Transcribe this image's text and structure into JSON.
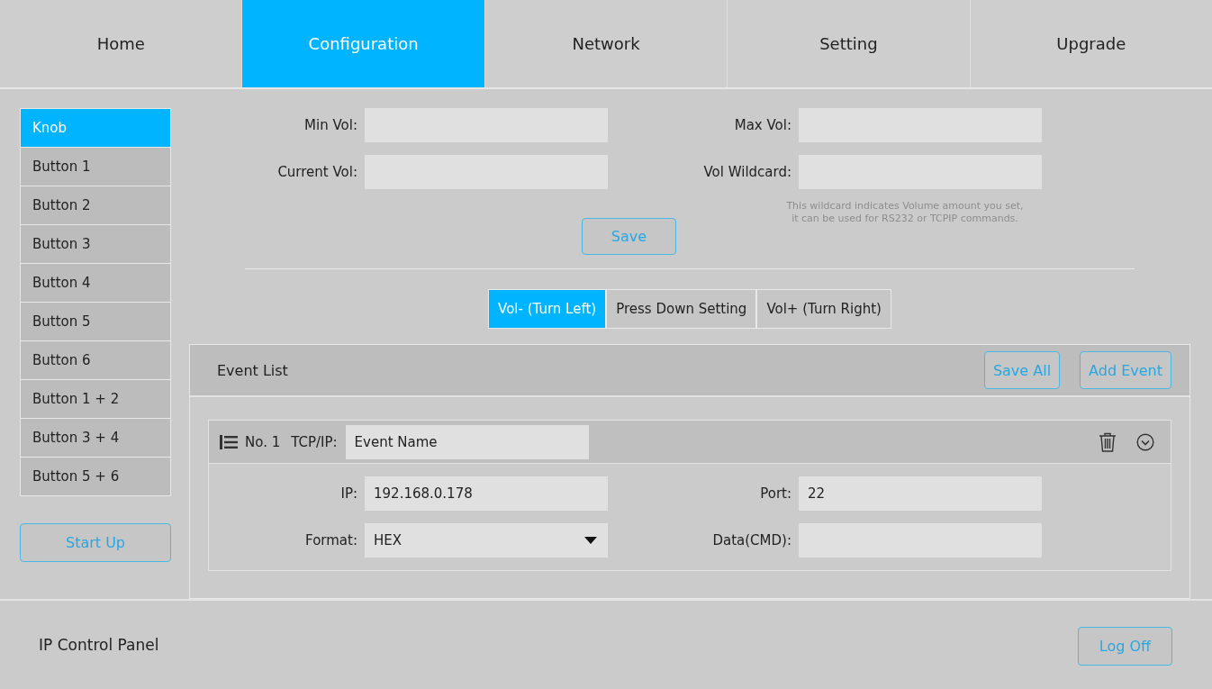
{
  "nav": {
    "tabs": [
      {
        "label": "Home",
        "selected": false
      },
      {
        "label": "Configuration",
        "selected": true
      },
      {
        "label": "Network",
        "selected": false
      },
      {
        "label": "Setting",
        "selected": false
      },
      {
        "label": "Upgrade",
        "selected": false
      }
    ]
  },
  "sidebar": {
    "items": [
      {
        "label": "Knob",
        "selected": true
      },
      {
        "label": "Button 1",
        "selected": false
      },
      {
        "label": "Button 2",
        "selected": false
      },
      {
        "label": "Button 3",
        "selected": false
      },
      {
        "label": "Button 4",
        "selected": false
      },
      {
        "label": "Button 5",
        "selected": false
      },
      {
        "label": "Button 6",
        "selected": false
      },
      {
        "label": "Button 1 + 2",
        "selected": false
      },
      {
        "label": "Button 3 + 4",
        "selected": false
      },
      {
        "label": "Button 5 + 6",
        "selected": false
      }
    ],
    "startup_button": "Start Up"
  },
  "volume_form": {
    "fields": [
      {
        "label": "Min Vol:"
      },
      {
        "label": "Max Vol:"
      },
      {
        "label": "Current Vol:"
      },
      {
        "label": "Vol Wildcard:"
      }
    ],
    "note": "This wildcard indicates Volume amount you set,\nit can be used for RS232 or TCPIP commands.",
    "save_button": "Save"
  },
  "event_tabs": [
    {
      "label": "Vol- (Turn Left)",
      "selected": true
    },
    {
      "label": "Press Down Setting",
      "selected": false
    },
    {
      "label": "Vol+ (Turn Right)",
      "selected": false
    }
  ],
  "event_list": {
    "title": "Event List",
    "buttons": [
      "Save All",
      "Add Event"
    ],
    "events": [
      {
        "number": "No. 1",
        "protocol_label": "TCP/IP:",
        "name": "Event Name",
        "fields": [
          {
            "label": "IP:",
            "value": "192.168.0.178",
            "kind": "text"
          },
          {
            "label": "Port:",
            "value": "22",
            "kind": "text"
          },
          {
            "label": "Format:",
            "value": "HEX",
            "kind": "select"
          },
          {
            "label": "Data(CMD):",
            "kind": "text"
          }
        ]
      }
    ]
  },
  "footer": {
    "title": "IP Control Panel",
    "logoff_button": "Log Off"
  }
}
